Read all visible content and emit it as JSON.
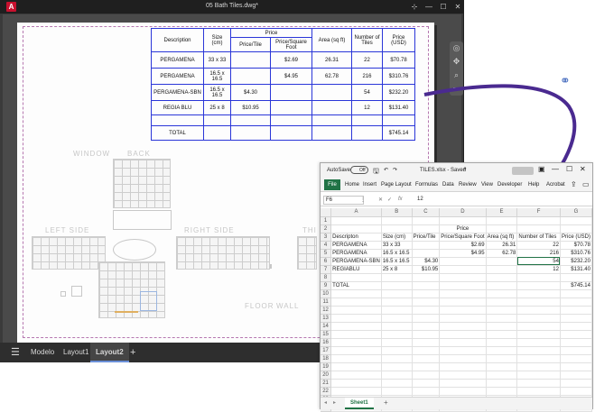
{
  "cad": {
    "title": "05 Bath Tiles.dwg*",
    "logo_letter": "A",
    "table_header": {
      "description": "Description",
      "size": "Size (cm)",
      "price": "Price",
      "price_tile": "Price/Tile",
      "price_sqft": "Price/Square Foot",
      "area": "Area (sq ft)",
      "number_tiles": "Number of Tiles",
      "price_usd": "Price (USD)"
    },
    "table_rows": [
      {
        "desc": "PERGAMENA",
        "size": "33 x 33",
        "tile": "",
        "sqft": "$2.69",
        "area": "26.31",
        "num": "22",
        "usd": "$70.78"
      },
      {
        "desc": "PERGAMENA",
        "size": "16.5 x 16.5",
        "tile": "",
        "sqft": "$4.95",
        "area": "62.78",
        "num": "216",
        "usd": "$310.76"
      },
      {
        "desc": "PERGAMENA-SBN",
        "size": "16.5 x 16.5",
        "tile": "$4.30",
        "sqft": "",
        "area": "",
        "num": "54",
        "usd": "$232.20"
      },
      {
        "desc": "REGIA BLU",
        "size": "25 x 8",
        "tile": "$10.95",
        "sqft": "",
        "area": "",
        "num": "12",
        "usd": "$131.40"
      }
    ],
    "total_label": "TOTAL",
    "total_value": "$745.14",
    "labels": {
      "window": "WINDOW",
      "back": "BACK",
      "left": "LEFT SIDE",
      "right": "RIGHT SIDE",
      "third": "THI",
      "floor": "FLOOR",
      "wall": "WALL"
    },
    "tabs": {
      "model": "Modelo",
      "layout1": "Layout1",
      "layout2": "Layout2",
      "add": "+",
      "menu_icon": "hamburger-icon"
    }
  },
  "excel": {
    "autosave_label": "AutoSave",
    "autosave_state": "Off",
    "file_title": "TILES.xlsx - Saved",
    "ribbon": [
      "File",
      "Home",
      "Insert",
      "Page Layout",
      "Formulas",
      "Data",
      "Review",
      "View",
      "Developer",
      "Help",
      "Acrobat"
    ],
    "name_box": "F6",
    "fx": "fx",
    "formula_value": "12",
    "columns": [
      "A",
      "B",
      "C",
      "D",
      "E",
      "F",
      "G"
    ],
    "row_numbers": [
      "1",
      "2",
      "3",
      "4",
      "5",
      "6",
      "7",
      "8",
      "9",
      "10",
      "11",
      "12",
      "13",
      "14",
      "15",
      "16",
      "17",
      "18",
      "19",
      "20",
      "21",
      "22",
      "23",
      "24"
    ],
    "rows": [
      [
        "",
        "",
        "",
        "",
        "",
        "",
        ""
      ],
      [
        "",
        "",
        "",
        "Price",
        "",
        "",
        ""
      ],
      [
        "Descripton",
        "Size (cm)",
        "Price/Tile",
        "Price/Square Foot",
        "Area (sq ft)",
        "Number of Tiles",
        "Price (USD)"
      ],
      [
        "PERGAMENA",
        "33 x 33",
        "",
        "$2.69",
        "26.31",
        "22",
        "$70.78"
      ],
      [
        "PERGAMENA",
        "16.5 x 16.5",
        "",
        "$4.95",
        "62.78",
        "216",
        "$310.76"
      ],
      [
        "PERGAMENA-SBN",
        "16.5 x 16.5",
        "$4.30",
        "",
        "",
        "54",
        "$232.20"
      ],
      [
        "REGIABLU",
        "25 x 8",
        "$10.95",
        "",
        "",
        "12",
        "$131.40"
      ],
      [
        "",
        "",
        "",
        "",
        "",
        "",
        ""
      ],
      [
        "TOTAL",
        "",
        "",
        "",
        "",
        "",
        "$745.14"
      ]
    ],
    "sheet_tab": "Sheet1",
    "add_sheet": "+"
  },
  "colors": {
    "autocad_red": "#c8102e",
    "excel_green": "#217346",
    "cad_table_line": "#2a36d8",
    "arrow": "#4a2a90"
  }
}
